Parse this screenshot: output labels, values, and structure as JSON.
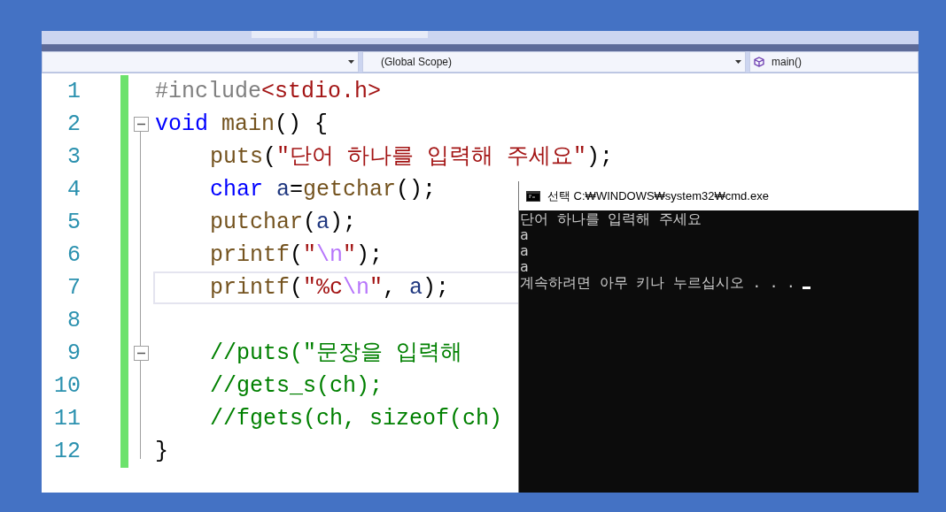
{
  "navigation_bar": {
    "dropdowns": [
      {
        "kind": "blank"
      },
      {
        "kind": "text",
        "label": "(Global Scope)"
      },
      {
        "kind": "member",
        "label": "main()"
      }
    ]
  },
  "editor": {
    "lines": [
      {
        "number": "1",
        "indented": false,
        "foldable": false,
        "current": false,
        "tokens": [
          {
            "kind": "preproc",
            "text": "#include"
          },
          {
            "kind": "string",
            "text": "<stdio.h>"
          }
        ]
      },
      {
        "number": "2",
        "indented": false,
        "foldable": true,
        "current": false,
        "tokens": [
          {
            "kind": "keyword",
            "text": "void"
          },
          {
            "kind": "function",
            "text": " main"
          },
          {
            "kind": "plain",
            "text": "() {"
          }
        ]
      },
      {
        "number": "3",
        "indented": true,
        "foldable": false,
        "current": false,
        "tokens": [
          {
            "kind": "function",
            "text": "puts"
          },
          {
            "kind": "plain",
            "text": "("
          },
          {
            "kind": "string",
            "text": "\"단어 하나를 입력해 주세요\""
          },
          {
            "kind": "plain",
            "text": ");"
          }
        ]
      },
      {
        "number": "4",
        "indented": true,
        "foldable": false,
        "current": false,
        "tokens": [
          {
            "kind": "keyword",
            "text": "char"
          },
          {
            "kind": "variable",
            "text": " a"
          },
          {
            "kind": "plain",
            "text": "="
          },
          {
            "kind": "function",
            "text": "getchar"
          },
          {
            "kind": "plain",
            "text": "();"
          }
        ]
      },
      {
        "number": "5",
        "indented": true,
        "foldable": false,
        "current": false,
        "tokens": [
          {
            "kind": "function",
            "text": "putchar"
          },
          {
            "kind": "plain",
            "text": "("
          },
          {
            "kind": "variable",
            "text": "a"
          },
          {
            "kind": "plain",
            "text": ");"
          }
        ]
      },
      {
        "number": "6",
        "indented": true,
        "foldable": false,
        "current": false,
        "tokens": [
          {
            "kind": "function",
            "text": "printf"
          },
          {
            "kind": "plain",
            "text": "("
          },
          {
            "kind": "string",
            "text": "\""
          },
          {
            "kind": "escape",
            "text": "\\n"
          },
          {
            "kind": "string",
            "text": "\""
          },
          {
            "kind": "plain",
            "text": ");"
          }
        ]
      },
      {
        "number": "7",
        "indented": true,
        "foldable": false,
        "current": true,
        "tokens": [
          {
            "kind": "function",
            "text": "printf"
          },
          {
            "kind": "plain",
            "text": "("
          },
          {
            "kind": "string",
            "text": "\"%c"
          },
          {
            "kind": "escape",
            "text": "\\n"
          },
          {
            "kind": "string",
            "text": "\""
          },
          {
            "kind": "plain",
            "text": ", "
          },
          {
            "kind": "variable",
            "text": "a"
          },
          {
            "kind": "plain",
            "text": ");"
          }
        ]
      },
      {
        "number": "8",
        "foldable": false,
        "current": false
      },
      {
        "number": "9",
        "indented": true,
        "foldable": true,
        "current": false,
        "tokens": [
          {
            "kind": "comment",
            "text": "//puts(\"문장을 입력해"
          }
        ]
      },
      {
        "number": "10",
        "indented": true,
        "foldable": false,
        "current": false,
        "tokens": [
          {
            "kind": "comment",
            "text": "//gets_s(ch);"
          }
        ]
      },
      {
        "number": "11",
        "indented": true,
        "foldable": false,
        "current": false,
        "tokens": [
          {
            "kind": "comment",
            "text": "//fgets(ch, sizeof(ch)"
          }
        ]
      },
      {
        "number": "12",
        "indented": false,
        "foldable": false,
        "current": false,
        "tokens": [
          {
            "kind": "plain",
            "text": "}"
          }
        ]
      }
    ]
  },
  "console_window": {
    "title": "선택 C:₩WINDOWS₩system32₩cmd.exe",
    "output": [
      "단어 하나를 입력해 주세요",
      "a",
      "a",
      "a",
      "계속하려면 아무 키나 누르십시오 . . ."
    ]
  }
}
